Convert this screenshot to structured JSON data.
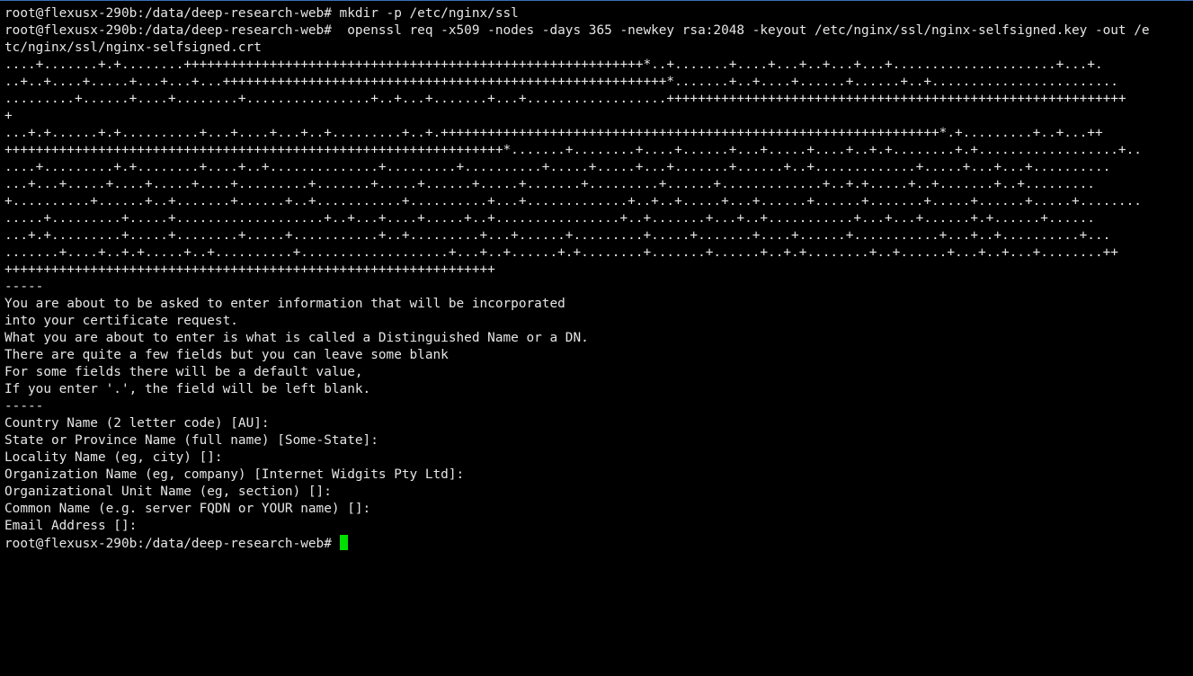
{
  "terminal": {
    "cursor_color": "#00e000",
    "text_color": "#e6e6e6",
    "background_color": "#000000",
    "prompt": "root@flexusx-290b:/data/deep-research-web#",
    "lines": [
      "root@flexusx-290b:/data/deep-research-web# mkdir -p /etc/nginx/ssl",
      "root@flexusx-290b:/data/deep-research-web#  openssl req -x509 -nodes -days 365 -newkey rsa:2048 -keyout /etc/nginx/ssl/nginx-selfsigned.key -out /e",
      "tc/nginx/ssl/nginx-selfsigned.crt",
      "....+.......+.+........+++++++++++++++++++++++++++++++++++++++++++++++++++++++++++*..+.......+....+...+..+...+...+.....................+...+.",
      "..+..+....+.....+...+...+...+++++++++++++++++++++++++++++++++++++++++++++++++++++++++*.......+..+....+......+......+..+........................",
      ".........+......+....+........+................+..+...+.......+...+..................+++++++++++++++++++++++++++++++++++++++++++++++++++++++++++",
      "+",
      "...+.+......+.+..........+...+....+...+..+.........+..+.++++++++++++++++++++++++++++++++++++++++++++++++++++++++++++++++*.+.........+..+...++",
      "++++++++++++++++++++++++++++++++++++++++++++++++++++++++++++++++*.......+........+....+......+...+.....+....+..+.+........+.+..................+..",
      "....+.........+.+........+....+..+..............+.........+..........+.....+.....+...+.......+......+..+.............+.....+...+...+..........",
      "...+...+.....+....+.....+....+.........+.......+.....+......+.....+.......+.........+......+.............+..+.+.....+..+.......+..+.........",
      "+..........+......+..+.......+......+..+...........+..........+...+.............+..+..+.....+...+......+......+.......+.....+......+.....+........",
      ".....+.........+.....+...................+..+...+....+.....+..+................+..+.......+...+..+...........+...+...+......+.+......+......",
      "...+.+.........+.....+........+.....+...........+..+.........+...+......+.........+.....+.......+....+......+...........+...+..+..........+...",
      ".......+....+..+.+.....+..+..........+...................+...+..+......+.+........+.......+......+..+.+........+..+......+...+..+...+........++",
      "+++++++++++++++++++++++++++++++++++++++++++++++++++++++++++++++",
      "-----",
      "You are about to be asked to enter information that will be incorporated",
      "into your certificate request.",
      "What you are about to enter is what is called a Distinguished Name or a DN.",
      "There are quite a few fields but you can leave some blank",
      "For some fields there will be a default value,",
      "If you enter '.', the field will be left blank.",
      "-----",
      "Country Name (2 letter code) [AU]:",
      "State or Province Name (full name) [Some-State]:",
      "Locality Name (eg, city) []:",
      "Organization Name (eg, company) [Internet Widgits Pty Ltd]:",
      "Organizational Unit Name (eg, section) []:",
      "Common Name (e.g. server FQDN or YOUR name) []:",
      "Email Address []:"
    ]
  }
}
